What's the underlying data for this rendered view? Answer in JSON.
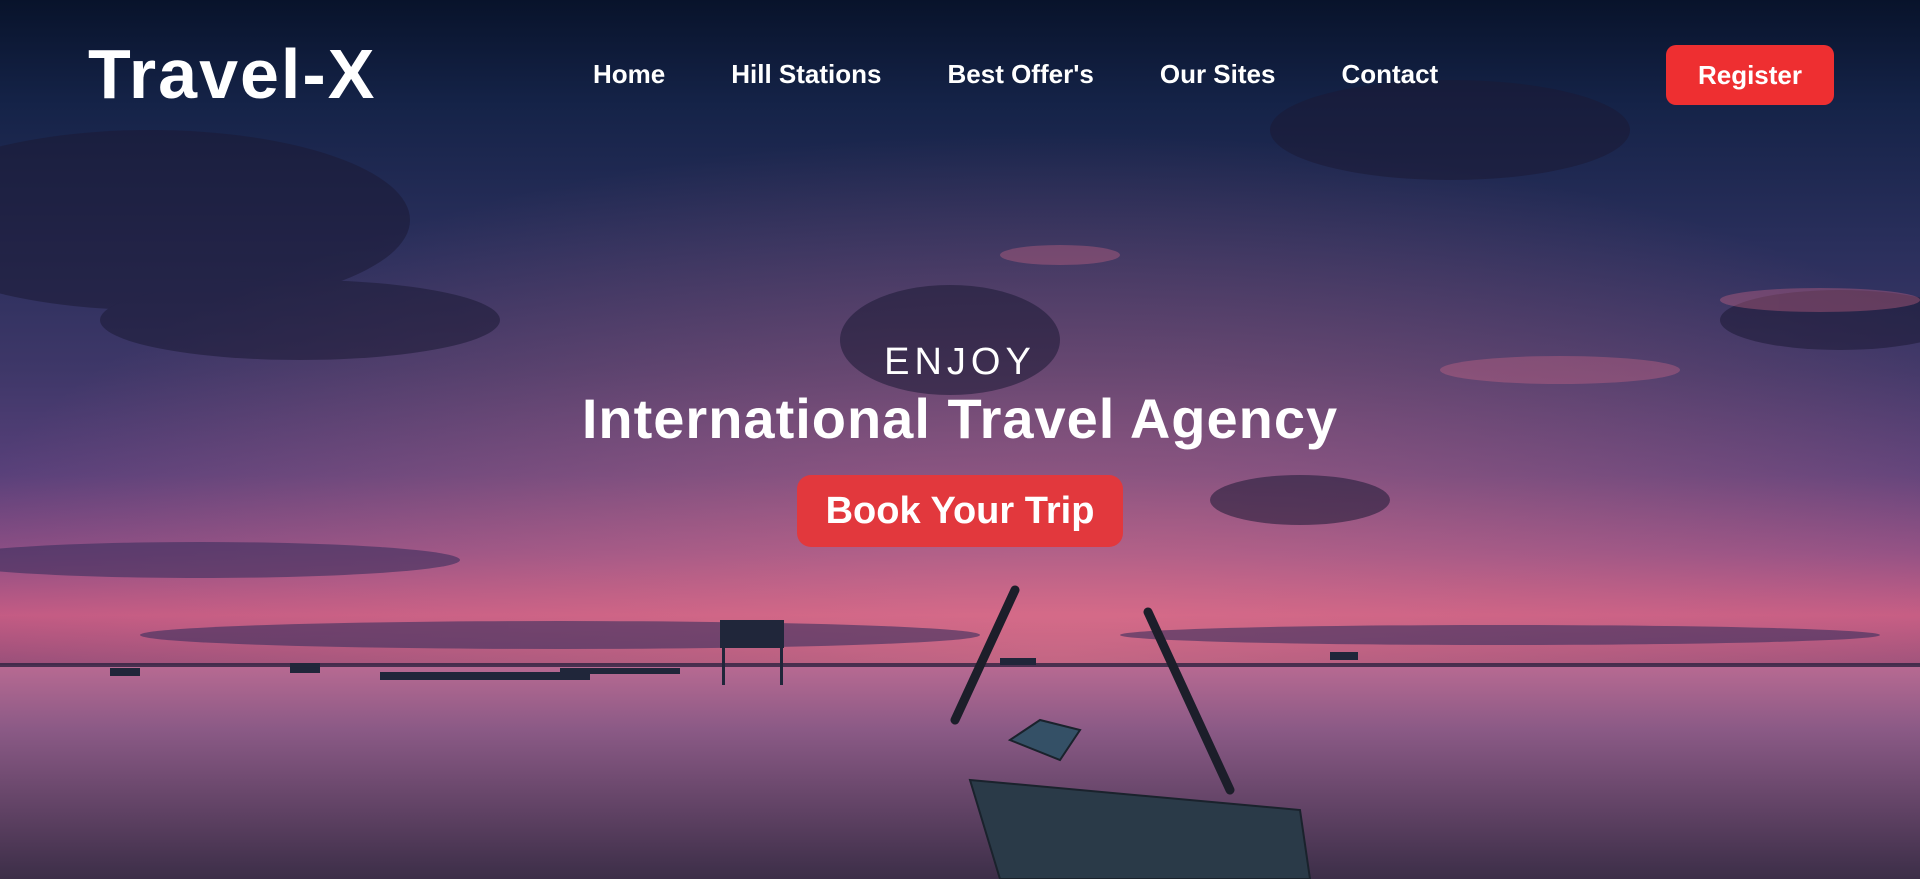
{
  "brand": {
    "logo": "Travel-X"
  },
  "nav": {
    "items": [
      {
        "label": "Home"
      },
      {
        "label": "Hill Stations"
      },
      {
        "label": "Best Offer's"
      },
      {
        "label": "Our Sites"
      },
      {
        "label": "Contact"
      }
    ],
    "register_label": "Register"
  },
  "hero": {
    "eyebrow": "ENJOY",
    "title": "International Travel Agency",
    "cta_label": "Book Your Trip"
  },
  "colors": {
    "accent": "#ee2f31",
    "cta": "#e2383d",
    "text": "#ffffff"
  }
}
